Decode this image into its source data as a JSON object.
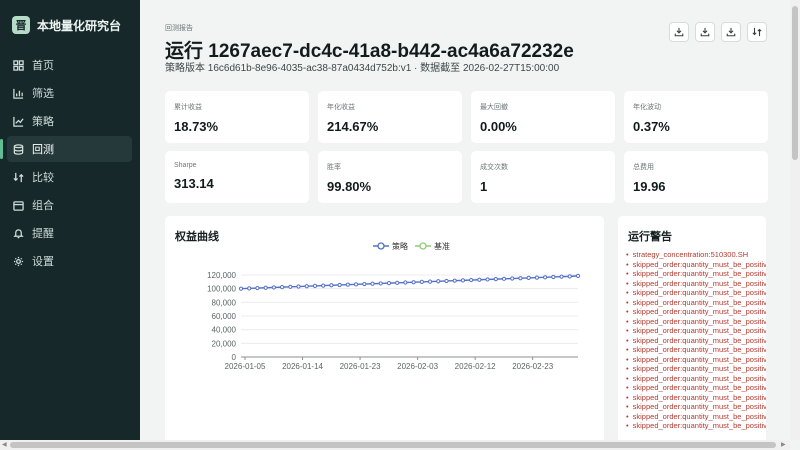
{
  "app": {
    "title": "本地量化研究台",
    "logo_glyph": "晋"
  },
  "sidebar": {
    "items": [
      {
        "label": "首页",
        "icon": "grid-icon"
      },
      {
        "label": "筛选",
        "icon": "bars-icon"
      },
      {
        "label": "策略",
        "icon": "trend-icon"
      },
      {
        "label": "回测",
        "icon": "database-icon",
        "active": true
      },
      {
        "label": "比较",
        "icon": "compare-icon"
      },
      {
        "label": "组合",
        "icon": "portfolio-icon"
      },
      {
        "label": "提醒",
        "icon": "bell-icon"
      },
      {
        "label": "设置",
        "icon": "gear-icon"
      }
    ]
  },
  "header": {
    "breadcrumb": "回测报告",
    "title": "运行 1267aec7-dc4c-41a8-b442-ac4a6a72232e",
    "subtitle": "策略版本 16c6d61b-8e96-4035-ac38-87a0434d752b:v1 · 数据截至 2026-02-27T15:00:00",
    "action_icons": [
      "download-icon",
      "download-icon",
      "download-icon",
      "compare-icon"
    ]
  },
  "metrics": [
    {
      "label": "累计收益",
      "value": "18.73%"
    },
    {
      "label": "年化收益",
      "value": "214.67%"
    },
    {
      "label": "最大回撤",
      "value": "0.00%"
    },
    {
      "label": "年化波动",
      "value": "0.37%"
    },
    {
      "label": "Sharpe",
      "value": "313.14"
    },
    {
      "label": "胜率",
      "value": "99.80%"
    },
    {
      "label": "成交次数",
      "value": "1"
    },
    {
      "label": "总费用",
      "value": "19.96"
    }
  ],
  "equity_card": {
    "title": "权益曲线"
  },
  "chart_data": {
    "type": "line",
    "title": "权益曲线",
    "x_ticks": [
      "2026-01-05",
      "2026-01-14",
      "2026-01-23",
      "2026-02-03",
      "2026-02-12",
      "2026-02-23"
    ],
    "y_ticks": [
      "0",
      "20,000",
      "40,000",
      "60,000",
      "80,000",
      "100,000",
      "120,000"
    ],
    "ylim": [
      0,
      120000
    ],
    "legend_position": "top-center",
    "series": [
      {
        "name": "策略",
        "color": "#5470c6",
        "values": [
          100000,
          100450,
          100900,
          101350,
          101800,
          102250,
          102700,
          103150,
          103600,
          104050,
          104500,
          104950,
          105400,
          105850,
          106300,
          106750,
          107200,
          107650,
          108100,
          108550,
          109000,
          109450,
          109900,
          110350,
          110800,
          111250,
          111700,
          112150,
          112600,
          113050,
          113500,
          113950,
          114400,
          114850,
          115300,
          115750,
          116200,
          116650,
          117100,
          117550,
          118000,
          118730
        ]
      },
      {
        "name": "基准",
        "color": "#91cc75",
        "values": []
      }
    ]
  },
  "warnings": {
    "title": "运行警告",
    "items": [
      "strategy_concentration:510300.SH",
      "skipped_order:quantity_must_be_positive",
      "skipped_order:quantity_must_be_positive",
      "skipped_order:quantity_must_be_positive",
      "skipped_order:quantity_must_be_positive",
      "skipped_order:quantity_must_be_positive",
      "skipped_order:quantity_must_be_positive",
      "skipped_order:quantity_must_be_positive",
      "skipped_order:quantity_must_be_positive",
      "skipped_order:quantity_must_be_positive",
      "skipped_order:quantity_must_be_positive",
      "skipped_order:quantity_must_be_positive",
      "skipped_order:quantity_must_be_positive",
      "skipped_order:quantity_must_be_positive",
      "skipped_order:quantity_must_be_positive",
      "skipped_order:quantity_must_be_positive",
      "skipped_order:quantity_must_be_positive",
      "skipped_order:quantity_must_be_positive",
      "skipped_order:quantity_must_be_positive"
    ]
  }
}
